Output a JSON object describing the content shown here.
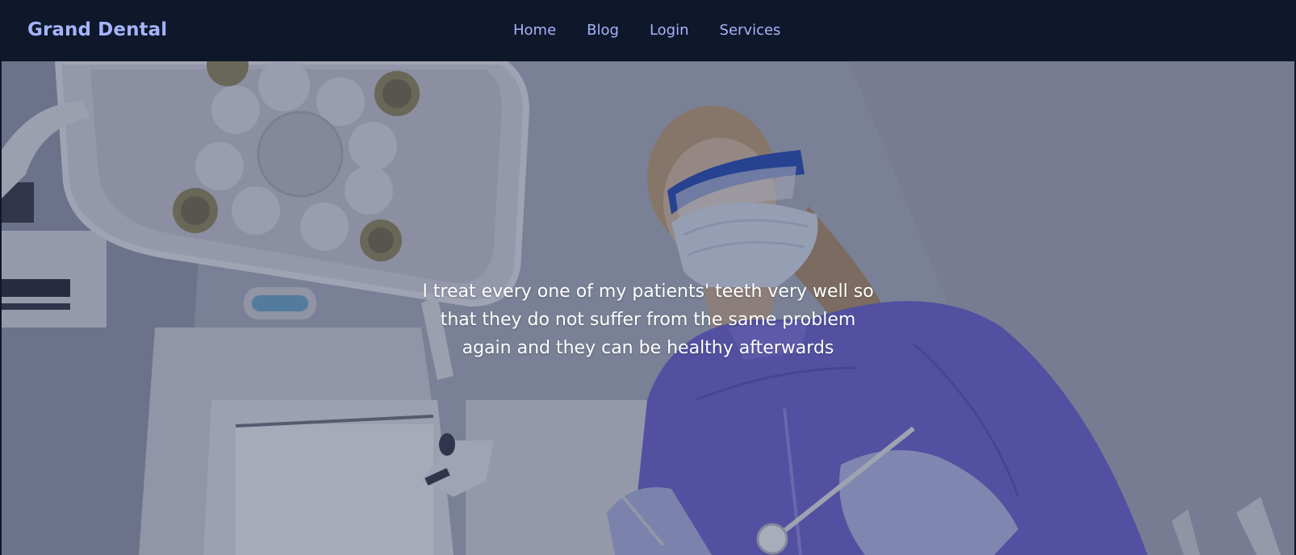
{
  "header": {
    "brand": "Grand Dental",
    "nav": [
      "Home",
      "Blog",
      "Login",
      "Services"
    ]
  },
  "hero": {
    "image": "dentist-with-mask-and-goggles-under-dental-lamp",
    "tagline": "I treat every one of my patients' teeth very well so that they do not suffer from the same problem again and they can be healthy afterwards"
  },
  "colors": {
    "navbar_bg": "#0f172a",
    "nav_text": "#a5b4fc",
    "hero_text": "#ffffff",
    "scrubs": "#6b63c9"
  }
}
